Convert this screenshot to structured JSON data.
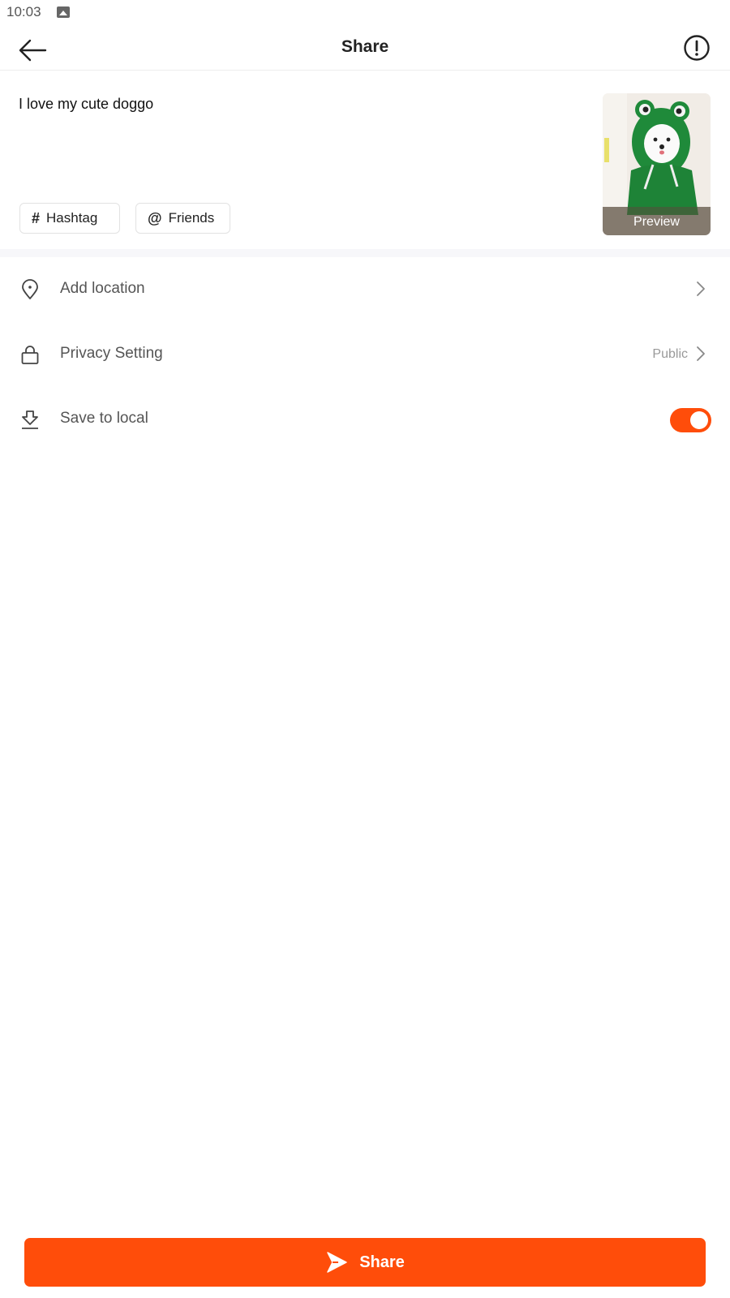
{
  "status_bar": {
    "time": "10:03",
    "notification_icon": "image-icon"
  },
  "header": {
    "title": "Share",
    "back_icon": "arrow-left-icon",
    "info_icon": "alert-circle-icon"
  },
  "post": {
    "caption": "I love my cute doggo",
    "chips": [
      {
        "icon": "#",
        "label": "Hashtag"
      },
      {
        "icon": "@",
        "label": "Friends"
      }
    ],
    "thumbnail": {
      "overlay_label": "Preview",
      "description": "white dog in green frog hoodie"
    }
  },
  "settings": {
    "items": [
      {
        "icon": "location-pin-icon",
        "label": "Add location",
        "value": "",
        "control": "chevron"
      },
      {
        "icon": "lock-icon",
        "label": "Privacy Setting",
        "value": "Public",
        "control": "chevron"
      },
      {
        "icon": "download-icon",
        "label": "Save to local",
        "value": "",
        "control": "toggle",
        "enabled": true
      }
    ]
  },
  "footer": {
    "share_label": "Share",
    "share_icon": "send-icon"
  },
  "colors": {
    "accent": "#FF4D0A",
    "divider": "#F7F7FA",
    "text_secondary": "#555555"
  }
}
